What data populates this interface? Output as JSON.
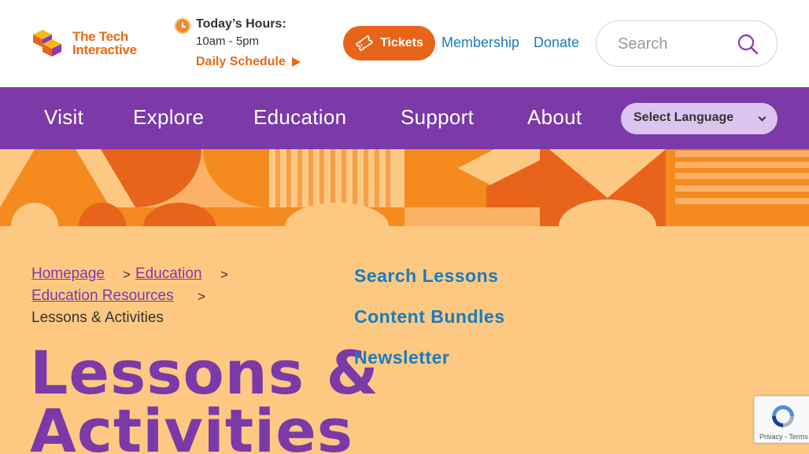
{
  "header": {
    "logo": {
      "line1": "The Tech",
      "line2": "Interactive"
    },
    "hours": {
      "title": "Today’s Hours:",
      "time": "10am - 5pm",
      "schedule_link": "Daily Schedule"
    },
    "tickets_label": "Tickets",
    "links": [
      "Membership",
      "Donate"
    ],
    "search": {
      "placeholder": "Search"
    }
  },
  "nav": {
    "items": [
      "Visit",
      "Explore",
      "Education",
      "Support",
      "About"
    ],
    "language": "Select Language"
  },
  "breadcrumb": {
    "items": [
      "Homepage",
      "Education",
      "Education Resources"
    ],
    "separator": ">",
    "current": "Lessons & Activities"
  },
  "page": {
    "title_line1": "Lessons &",
    "title_line2": "Activities"
  },
  "side_links": [
    "Search Lessons",
    "Content Bundles",
    "Newsletter"
  ],
  "recaptcha": {
    "text": "Privacy - Terms"
  },
  "colors": {
    "brand_orange": "#e8641a",
    "brand_purple": "#7b3aa8",
    "link_blue": "#1a7bbf",
    "content_bg": "#fdc982"
  }
}
